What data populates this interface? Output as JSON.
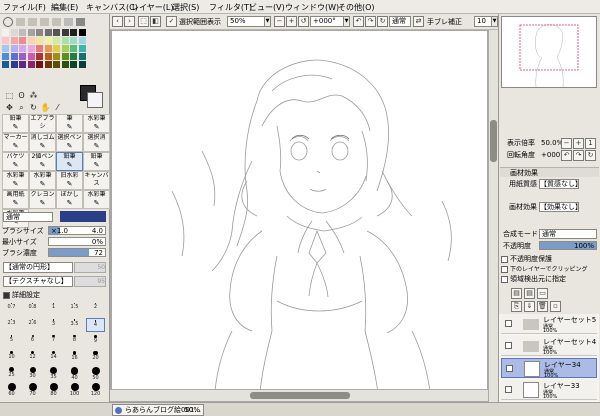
{
  "menu": [
    "ファイル(F)",
    "編集(E)",
    "キャンバス(C)",
    "レイヤー(L)",
    "選択(S)",
    "フィルタ(T)",
    "ビュー(V)",
    "ウィンドウ(W)",
    "その他(O)"
  ],
  "toolbar": {
    "show_selection_label": "選択範囲表示",
    "zoom": "50%",
    "rotation": "+000°",
    "mode": "通常",
    "stabilizer_label": "手ブレ補正",
    "stabilizer": "10"
  },
  "left": {
    "brush_groups": [
      "鉛筆",
      "エアブラシ",
      "筆",
      "水彩筆",
      "マーカー",
      "消しゴム",
      "選択ペン",
      "選択消",
      "バケツ",
      "2値ペン",
      "鉛筆",
      "鉛筆",
      "水彩筆",
      "水彩筆",
      "旧水彩",
      "キャンバス",
      "画用紙",
      "クレヨン",
      "ぼかし",
      "水彩筆",
      "水彩筆"
    ],
    "blend_mode": "通常",
    "brush_size_label": "ブラシサイズ",
    "brush_size_mult": "×1.0",
    "brush_size": "4.0",
    "min_size_label": "最小サイズ",
    "min_size": "0%",
    "density_label": "ブラシ濃度",
    "density": "72",
    "shape_label": "【通常の円形】",
    "texture_label": "【テクスチャなし】",
    "shape_value": "50",
    "texture_value": "95",
    "detail_label": "詳細設定",
    "sizes": [
      "0.7",
      "0.8",
      "1",
      "1.5",
      "2",
      "2.3",
      "2.6",
      "3",
      "3.5",
      "4",
      "5",
      "6",
      "7",
      "8",
      "9",
      "10",
      "12",
      "14",
      "16",
      "20",
      "25",
      "30",
      "35",
      "40",
      "50",
      "60",
      "70",
      "80",
      "100",
      "120"
    ]
  },
  "right": {
    "zoom_label": "表示倍率",
    "zoom": "50.0%",
    "rotate_label": "回転角度",
    "rotate": "+000°",
    "paper_effect_label": "画材効果",
    "paper_quality_label": "用紙質感",
    "paper_quality": "【質感なし】",
    "fx_label": "画材効果",
    "fx_value": "【効果なし】",
    "blend_label": "合成モード",
    "blend": "通常",
    "opacity_label": "不透明度",
    "opacity": "100%",
    "lock_opacity": "不透明度保護",
    "clip_lower": "下のレイヤーでクリッピング",
    "spec_source": "領域検出元に指定",
    "layers": [
      {
        "name": "レイヤーセット5",
        "mode": "通常",
        "opacity": "100%"
      },
      {
        "name": "レイヤーセット4",
        "mode": "通常",
        "opacity": "100%"
      },
      {
        "name": "レイヤー34",
        "mode": "通常",
        "opacity": "100%"
      },
      {
        "name": "レイヤー33",
        "mode": "通常",
        "opacity": "100%"
      }
    ]
  },
  "taskbar": {
    "doc": "らあらんブログ絵001...",
    "zoom": "50%"
  },
  "colors": {
    "accent": "#5d73c3",
    "selected_layer": "#aabbe6"
  }
}
